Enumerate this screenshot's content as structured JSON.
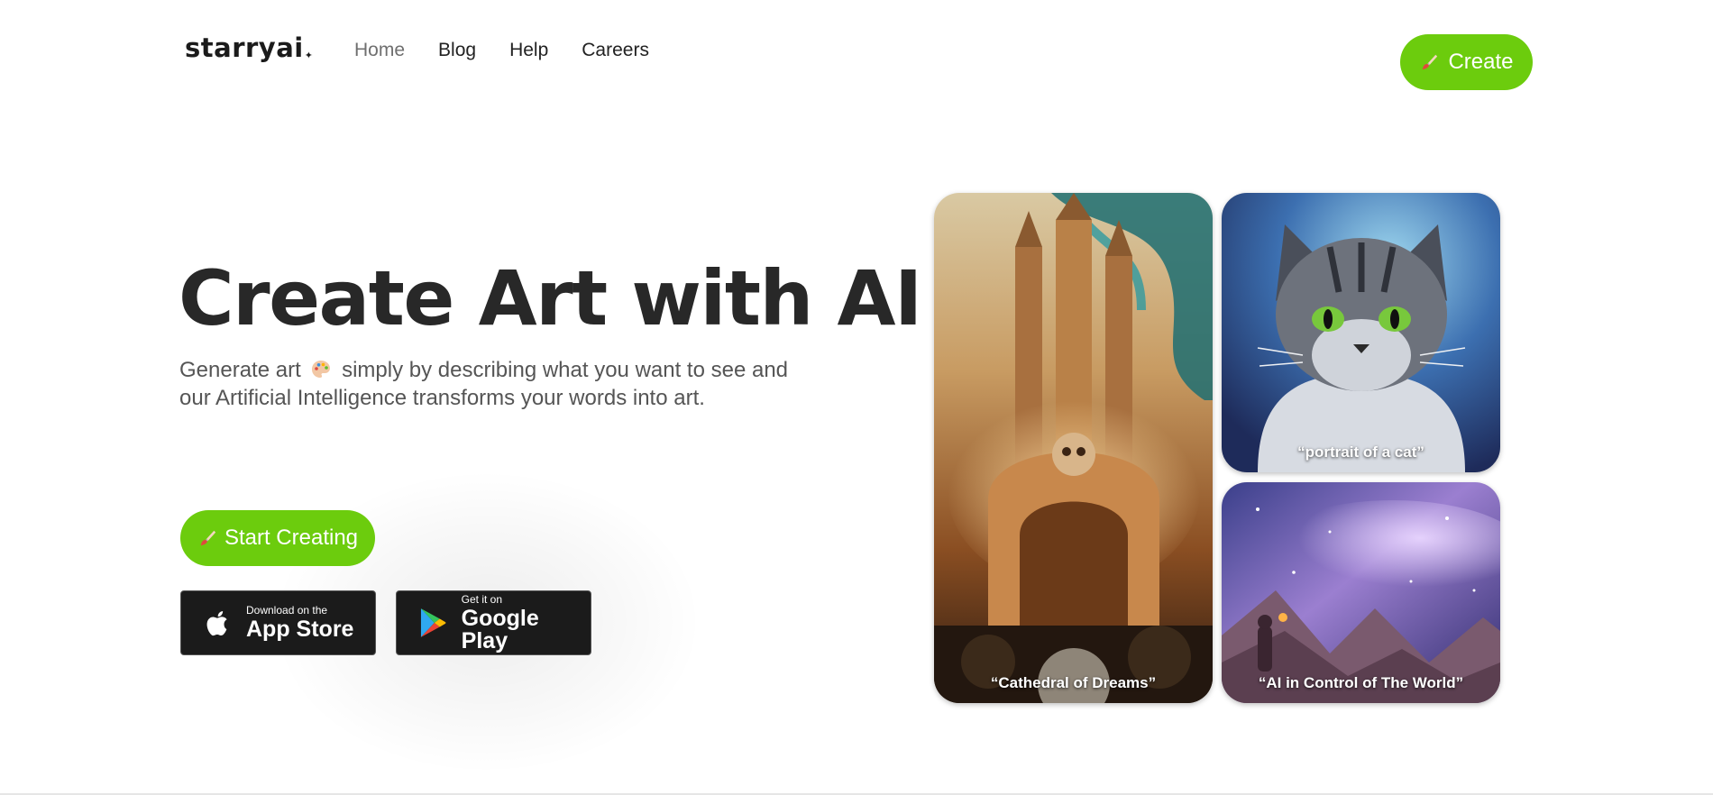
{
  "brand": {
    "logo": "starryai",
    "logo_star": "✦"
  },
  "nav": {
    "items": [
      {
        "label": "Home",
        "active": true
      },
      {
        "label": "Blog",
        "active": false
      },
      {
        "label": "Help",
        "active": false
      },
      {
        "label": "Careers",
        "active": false
      }
    ]
  },
  "header": {
    "create_label": "Create"
  },
  "hero": {
    "title": "Create Art with AI",
    "subtitle_before": "Generate art",
    "subtitle_after": "simply by describing what you want to see and our Artificial Intelligence transforms your words into art.",
    "cta_label": "Start Creating"
  },
  "stores": {
    "apple": {
      "small": "Download on the",
      "big": "App Store",
      "icon": "apple-icon"
    },
    "google": {
      "small": "Get it on",
      "big": "Google Play",
      "icon": "google-play-icon"
    }
  },
  "gallery": {
    "items": [
      {
        "caption": "“Cathedral of Dreams”"
      },
      {
        "caption": "“portrait of a cat”"
      },
      {
        "caption": "“AI in Control of The World”"
      }
    ]
  },
  "colors": {
    "accent": "#6ccc0d",
    "text": "#282828",
    "store_bg": "#1b1b1b"
  }
}
